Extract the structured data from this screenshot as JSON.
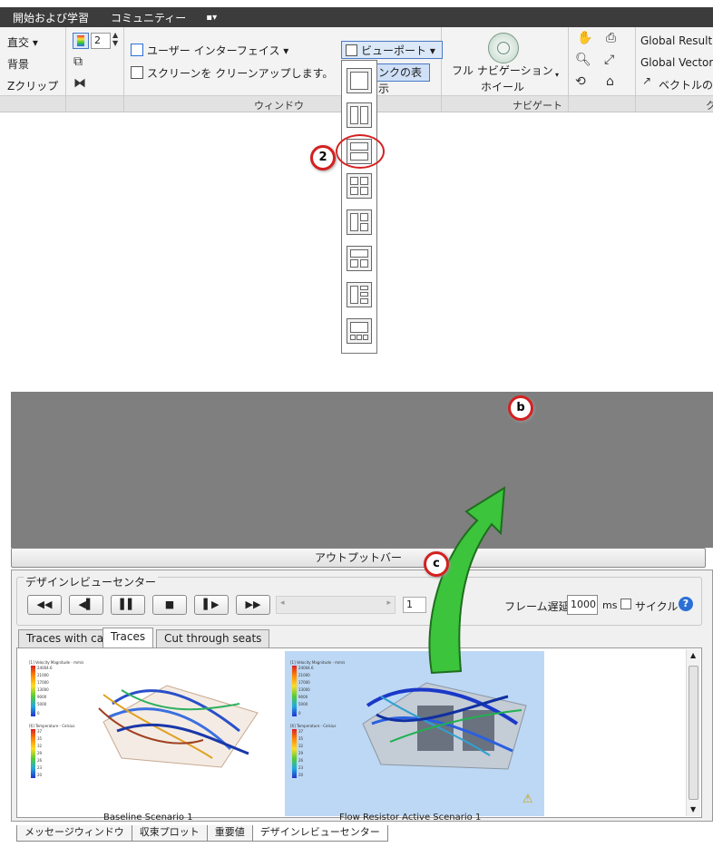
{
  "menu": {
    "items": [
      "開始および学習",
      "コミュニティー"
    ],
    "extra": "▪▾"
  },
  "ribbon": {
    "view_items": [
      "直交 ▾",
      "背景",
      "Zクリップ"
    ],
    "count_value": "2",
    "ui_label": "ユーザー インターフェイス ▾",
    "cleanup_label": "スクリーンを クリーンアップします。",
    "viewport_label": "ビューポート ▾",
    "link_label": "ンクの表示",
    "nav_wheel_label_1": "フル ナビゲーション",
    "nav_wheel_label_2": "ホイール",
    "global_result": "Global Result:",
    "global_vector": "Global Vector:",
    "vector_label": "ベクトルの",
    "groups": {
      "window": "ウィンドウ",
      "navigate": "ナビゲート",
      "right_cut": "ク"
    }
  },
  "callouts": {
    "two": "2",
    "b": "b",
    "c": "c"
  },
  "output_bar": "アウトプットバー",
  "design_center": {
    "title": "デザインレビューセンター",
    "controls": [
      "◀◀",
      "◀▌",
      "▌▌",
      "■",
      "▌▶",
      "▶▶"
    ],
    "frame": "1",
    "delay_label": "フレーム遅延:",
    "delay_value": "1000",
    "ms": "ms",
    "cycle_label": "サイクル",
    "help": "?"
  },
  "tabs": [
    "Traces with car",
    "Traces",
    "Cut through seats"
  ],
  "active_tab": 1,
  "thumbnails": [
    {
      "legend1_title": "[1] Velocity Magnitude - mm/s",
      "legend1_values": [
        "24004.6",
        "21000",
        "17000",
        "13000",
        "9000",
        "5000",
        "0"
      ],
      "legend2_title": "[6] Temperature - Celsius",
      "legend2_values": [
        "37",
        "35",
        "32",
        "29",
        "26",
        "23",
        "20"
      ],
      "caption": "Baseline Scenario 1"
    },
    {
      "legend1_title": "[1] Velocity Magnitude - mm/s",
      "legend1_values": [
        "24004.6",
        "21000",
        "17000",
        "13000",
        "9000",
        "5000",
        "0"
      ],
      "legend2_title": "[6] Temperature - Celsius",
      "legend2_values": [
        "37",
        "35",
        "32",
        "29",
        "26",
        "23",
        "20"
      ],
      "caption": "Flow Resistor Active Scenario 1"
    }
  ],
  "bottom_tabs": [
    "メッセージウィンドウ",
    "収束プロット",
    "重要値",
    "デザインレビューセンター"
  ],
  "colors": {
    "accent_red": "#d42020",
    "arrow_green": "#3cc43c",
    "selection_blue": "#bdd8f4"
  }
}
